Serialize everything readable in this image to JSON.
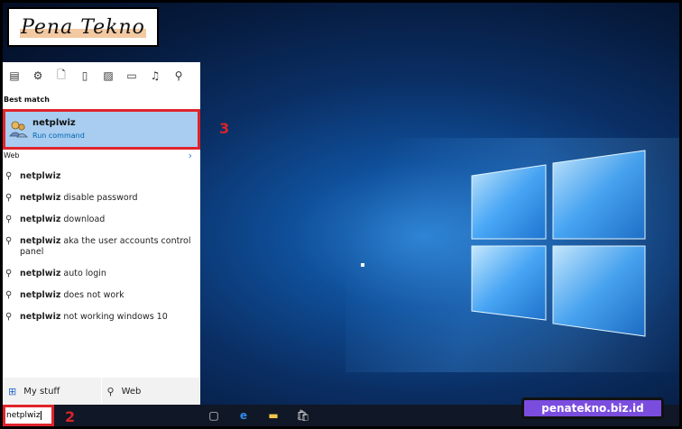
{
  "logo": {
    "text": "Pena Tekno"
  },
  "toolbar": {
    "icons": [
      "apps-icon",
      "gear-icon",
      "document-icon",
      "phone-icon",
      "image-icon",
      "video-icon",
      "music-icon",
      "search-icon"
    ]
  },
  "search_panel": {
    "best_match_label": "Best match",
    "best_match": {
      "title": "netplwiz",
      "subtitle": "Run command"
    },
    "web_label": "Web",
    "web_results": [
      {
        "bold": "netplwiz",
        "rest": ""
      },
      {
        "bold": "netplwiz",
        "rest": " disable password"
      },
      {
        "bold": "netplwiz",
        "rest": " download"
      },
      {
        "bold": "netplwiz",
        "rest": " aka the user accounts control panel"
      },
      {
        "bold": "netplwiz",
        "rest": " auto login"
      },
      {
        "bold": "netplwiz",
        "rest": " does not work"
      },
      {
        "bold": "netplwiz",
        "rest": " not working windows 10"
      }
    ],
    "bottom": {
      "my_stuff": "My stuff",
      "web": "Web"
    }
  },
  "taskbar": {
    "search_value": "netplwiz"
  },
  "annotations": {
    "step2": "2",
    "step3": "3"
  },
  "watermark": "penatekno.biz.id",
  "colors": {
    "highlight": "#a8cdf0",
    "annotation_red": "#e0242b",
    "watermark_bg": "#7b4ddf"
  }
}
